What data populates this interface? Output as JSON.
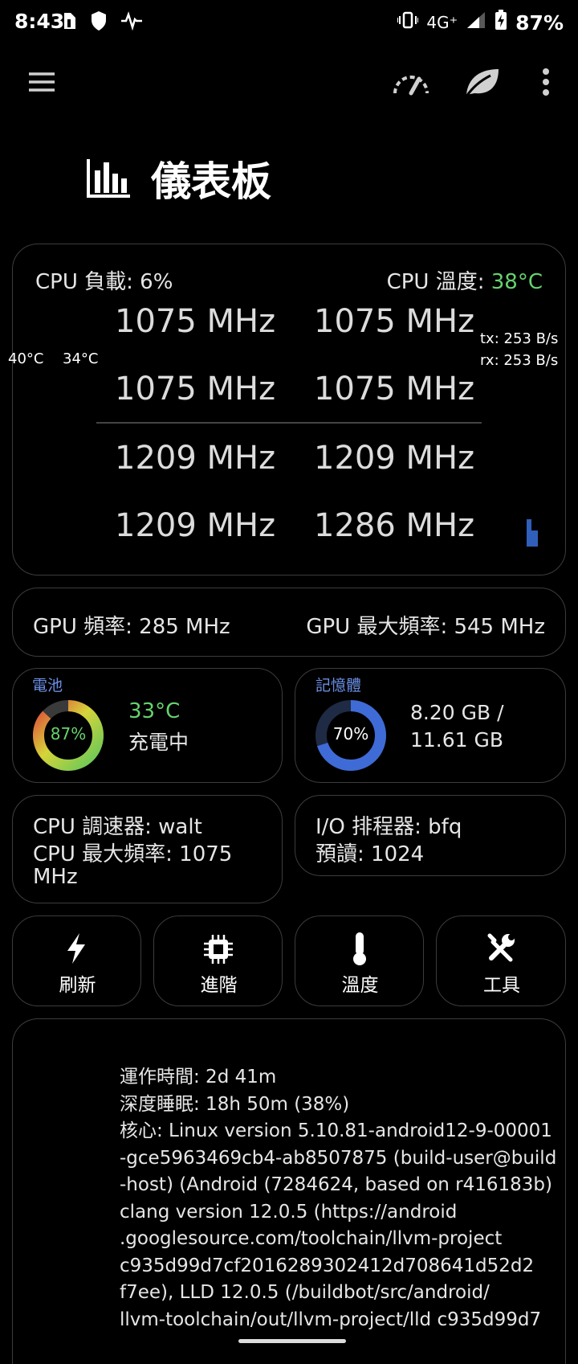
{
  "status_bar": {
    "time": "8:43",
    "network": "4G⁺",
    "battery": "87%"
  },
  "header": {
    "title": "儀表板"
  },
  "cpu_card": {
    "load_label": "CPU 負載: ",
    "load_value": "6%",
    "temp_label": "CPU 溫度: ",
    "temp_value": "38°C",
    "temp_a": "40°C",
    "temp_b": "34°C",
    "net_tx": "tx: 253 B/s",
    "net_rx": "rx: 253 B/s",
    "cores": [
      "1075 MHz",
      "1075 MHz",
      "1075 MHz",
      "1075 MHz",
      "1209 MHz",
      "1209 MHz",
      "1209 MHz",
      "1286 MHz"
    ]
  },
  "gpu_card": {
    "freq": "GPU 頻率: 285 MHz",
    "max_freq": "GPU 最大頻率: 545 MHz"
  },
  "battery_card": {
    "title": "電池",
    "percent": "87%",
    "percent_value": 87,
    "temp": "33°C",
    "status": "充電中"
  },
  "memory_card": {
    "title": "記憶體",
    "percent": "70%",
    "percent_value": 70,
    "used": "8.20 GB /",
    "total": "11.61 GB"
  },
  "governor_card": {
    "line1": "CPU 調速器: walt",
    "line2": "CPU 最大頻率: 1075",
    "line3": "MHz"
  },
  "io_card": {
    "line1": "I/O 排程器: bfq",
    "line2": "預讀: 1024"
  },
  "actions": [
    {
      "label": "刷新"
    },
    {
      "label": "進階"
    },
    {
      "label": "溫度"
    },
    {
      "label": "工具"
    }
  ],
  "info_card": {
    "lines": [
      "運作時間: 2d 41m",
      "深度睡眠: 18h 50m  (38%)",
      "核心: Linux version 5.10.81-android12-9-00001",
      "-gce5963469cb4-ab8507875 (build-user@build",
      "-host) (Android (7284624, based on r416183b)",
      "clang version 12.0.5 (https://android",
      ".googlesource.com/toolchain/llvm-project",
      "c935d99d7cf2016289302412d708641d52d2",
      "f7ee), LLD 12.0.5 (/buildbot/src/android/",
      "llvm-toolchain/out/llvm-project/lld c935d99d7"
    ]
  },
  "colors": {
    "accent_green": "#66d36e",
    "accent_blue": "#3f6bd6",
    "label_blue": "#6b8fe6",
    "card_border": "#3c3c3c"
  }
}
